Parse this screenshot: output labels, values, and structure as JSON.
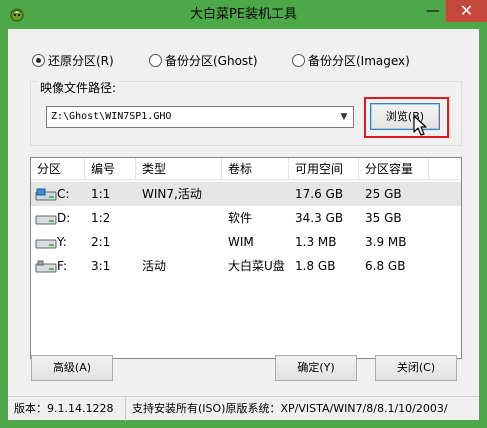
{
  "window": {
    "title": "大白菜PE装机工具",
    "minimize_glyph": "—",
    "close_glyph": "✕"
  },
  "mode": {
    "options": [
      {
        "label": "还原分区(R)",
        "checked": true
      },
      {
        "label": "备份分区(Ghost)",
        "checked": false
      },
      {
        "label": "备份分区(Imagex)",
        "checked": false
      }
    ]
  },
  "image": {
    "group_label": "映像文件路径:",
    "path_value": "Z:\\Ghost\\WIN7SP1.GHO",
    "browse_label": "浏览(B)"
  },
  "partitions": {
    "columns": [
      "分区",
      "编号",
      "类型",
      "卷标",
      "可用空间",
      "分区容量"
    ],
    "rows": [
      {
        "drive": "C:",
        "number": "1:1",
        "type": "WIN7,活动",
        "label": "",
        "free": "17.6 GB",
        "size": "25 GB",
        "selected": true
      },
      {
        "drive": "D:",
        "number": "1:2",
        "type": "",
        "label": "软件",
        "free": "34.3 GB",
        "size": "35 GB",
        "selected": false
      },
      {
        "drive": "Y:",
        "number": "2:1",
        "type": "",
        "label": "WIM",
        "free": "1.3 MB",
        "size": "3.9 MB",
        "selected": false
      },
      {
        "drive": "F:",
        "number": "3:1",
        "type": "活动",
        "label": "大白菜U盘",
        "free": "1.8 GB",
        "size": "6.8 GB",
        "selected": false
      }
    ]
  },
  "buttons": {
    "advanced": "高级(A)",
    "ok": "确定(Y)",
    "close": "关闭(C)"
  },
  "status": {
    "version": "版本：9.1.14.1228",
    "support": "支持安装所有(ISO)原版系统：XP/VISTA/WIN7/8/8.1/10/2003/"
  },
  "colors": {
    "frame": "#4da84a",
    "close_button": "#c6473c",
    "highlight_box": "#e3171f",
    "selected_row": "#e5e5e5"
  }
}
